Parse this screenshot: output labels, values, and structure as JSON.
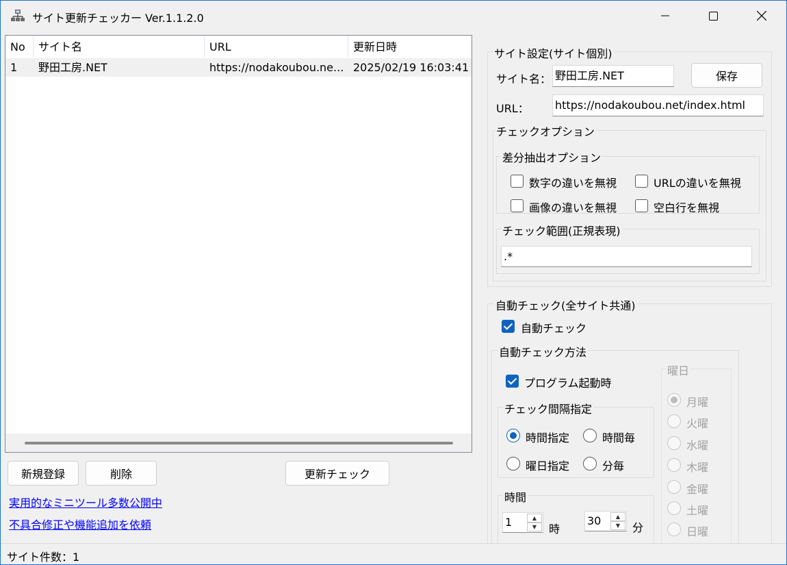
{
  "window": {
    "title": "サイト更新チェッカー Ver.1.1.2.0"
  },
  "list": {
    "columns": [
      "No",
      "サイト名",
      "URL",
      "更新日時"
    ],
    "rows": [
      {
        "no": "1",
        "name": "野田工房.NET",
        "url": "https://nodakoubou.ne...",
        "updated": "2025/02/19 16:03:41"
      }
    ]
  },
  "buttons": {
    "new": "新規登録",
    "delete": "削除",
    "check": "更新チェック",
    "save": "保存"
  },
  "links": {
    "tools": "実用的なミニツール多数公開中",
    "request": "不具合修正や機能追加を依頼"
  },
  "site_settings": {
    "group_label": "サイト設定(サイト個別)",
    "name_label": "サイト名：",
    "name_value": "野田工房.NET",
    "url_label": "URL：",
    "url_value": "https://nodakoubou.net/index.html",
    "check_option_label": "チェックオプション",
    "diff_option_label": "差分抽出オプション",
    "opt_ignore_digits": "数字の違いを無視",
    "opt_ignore_url": "URLの違いを無視",
    "opt_ignore_images": "画像の違いを無視",
    "opt_ignore_blank": "空白行を無視",
    "range_label": "チェック範囲(正規表現)",
    "range_value": ".*"
  },
  "auto_check": {
    "group_label": "自動チェック(全サイト共通)",
    "enabled_label": "自動チェック",
    "method_label": "自動チェック方法",
    "on_start_label": "プログラム起動時",
    "interval_label": "チェック間隔指定",
    "radio_time": "時間指定",
    "radio_hourly": "時間毎",
    "radio_weekday": "曜日指定",
    "radio_minutely": "分毎",
    "time_label": "時間",
    "hour_value": "1",
    "hour_unit": "時",
    "minute_value": "30",
    "minute_unit": "分",
    "weekday_label": "曜日",
    "weekdays": [
      "月曜",
      "火曜",
      "水曜",
      "木曜",
      "金曜",
      "土曜",
      "日曜"
    ]
  },
  "status": {
    "site_count": "サイト件数：1"
  },
  "icons": {
    "app": "network-icon",
    "minimize": "minimize-icon",
    "maximize": "maximize-icon",
    "close": "close-icon"
  },
  "colors": {
    "accent": "#0f63c0",
    "link": "#0000ff",
    "border": "#1e6fd0"
  }
}
